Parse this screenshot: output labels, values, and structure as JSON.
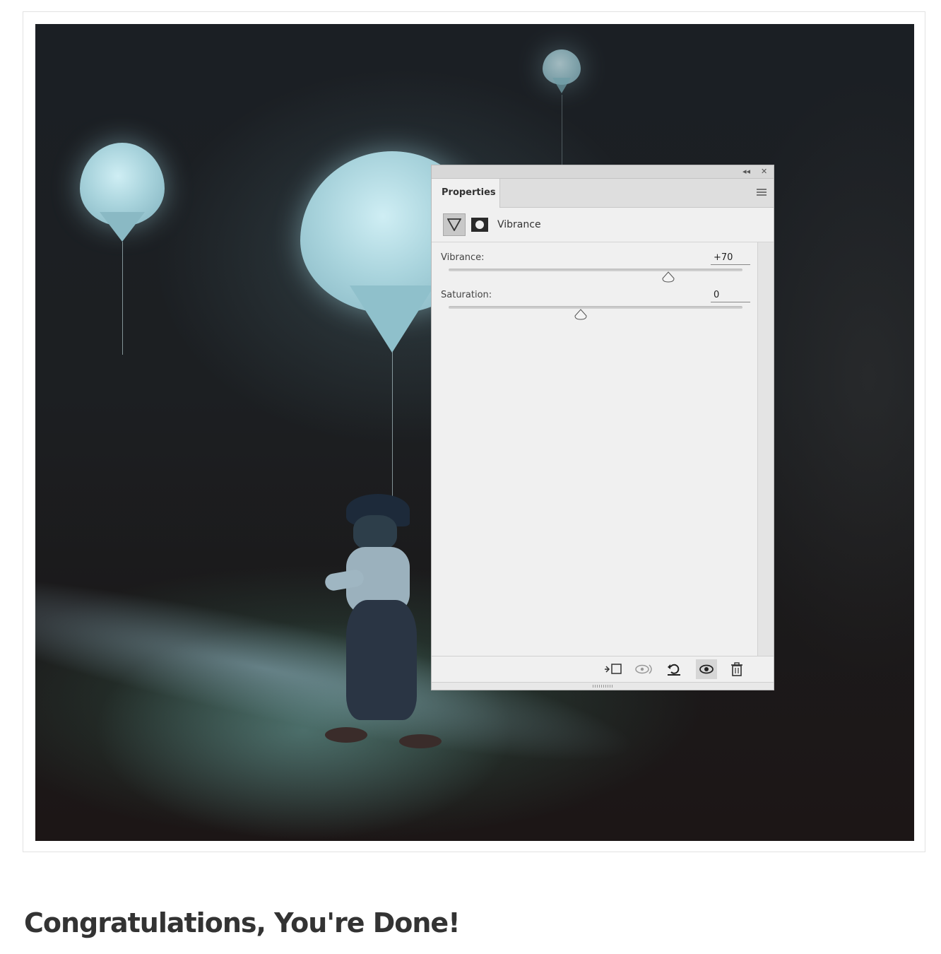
{
  "panel": {
    "tab_label": "Properties",
    "collapse_glyph": "◂◂",
    "close_glyph": "✕",
    "adjustment_name": "Vibrance",
    "adjustment_icon": "vibrance-triangle-icon",
    "mask_icon": "layer-mask-icon",
    "sliders": [
      {
        "label": "Vibrance:",
        "value": "+70",
        "min": -100,
        "max": 100,
        "level": 70
      },
      {
        "label": "Saturation:",
        "value": "0",
        "min": -100,
        "max": 100,
        "level": 0
      }
    ],
    "footer_icons": [
      "clip-to-layer-icon",
      "view-previous-state-icon",
      "reset-icon",
      "visibility-eye-icon",
      "trash-icon"
    ]
  },
  "scene": {
    "subject": "child walking with moon balloon",
    "colors": {
      "balloon_glow": "#bfe6ee",
      "grass": "#3f6a55",
      "night": "#1b1f24"
    }
  },
  "page": {
    "heading": "Congratulations, You're Done!"
  }
}
